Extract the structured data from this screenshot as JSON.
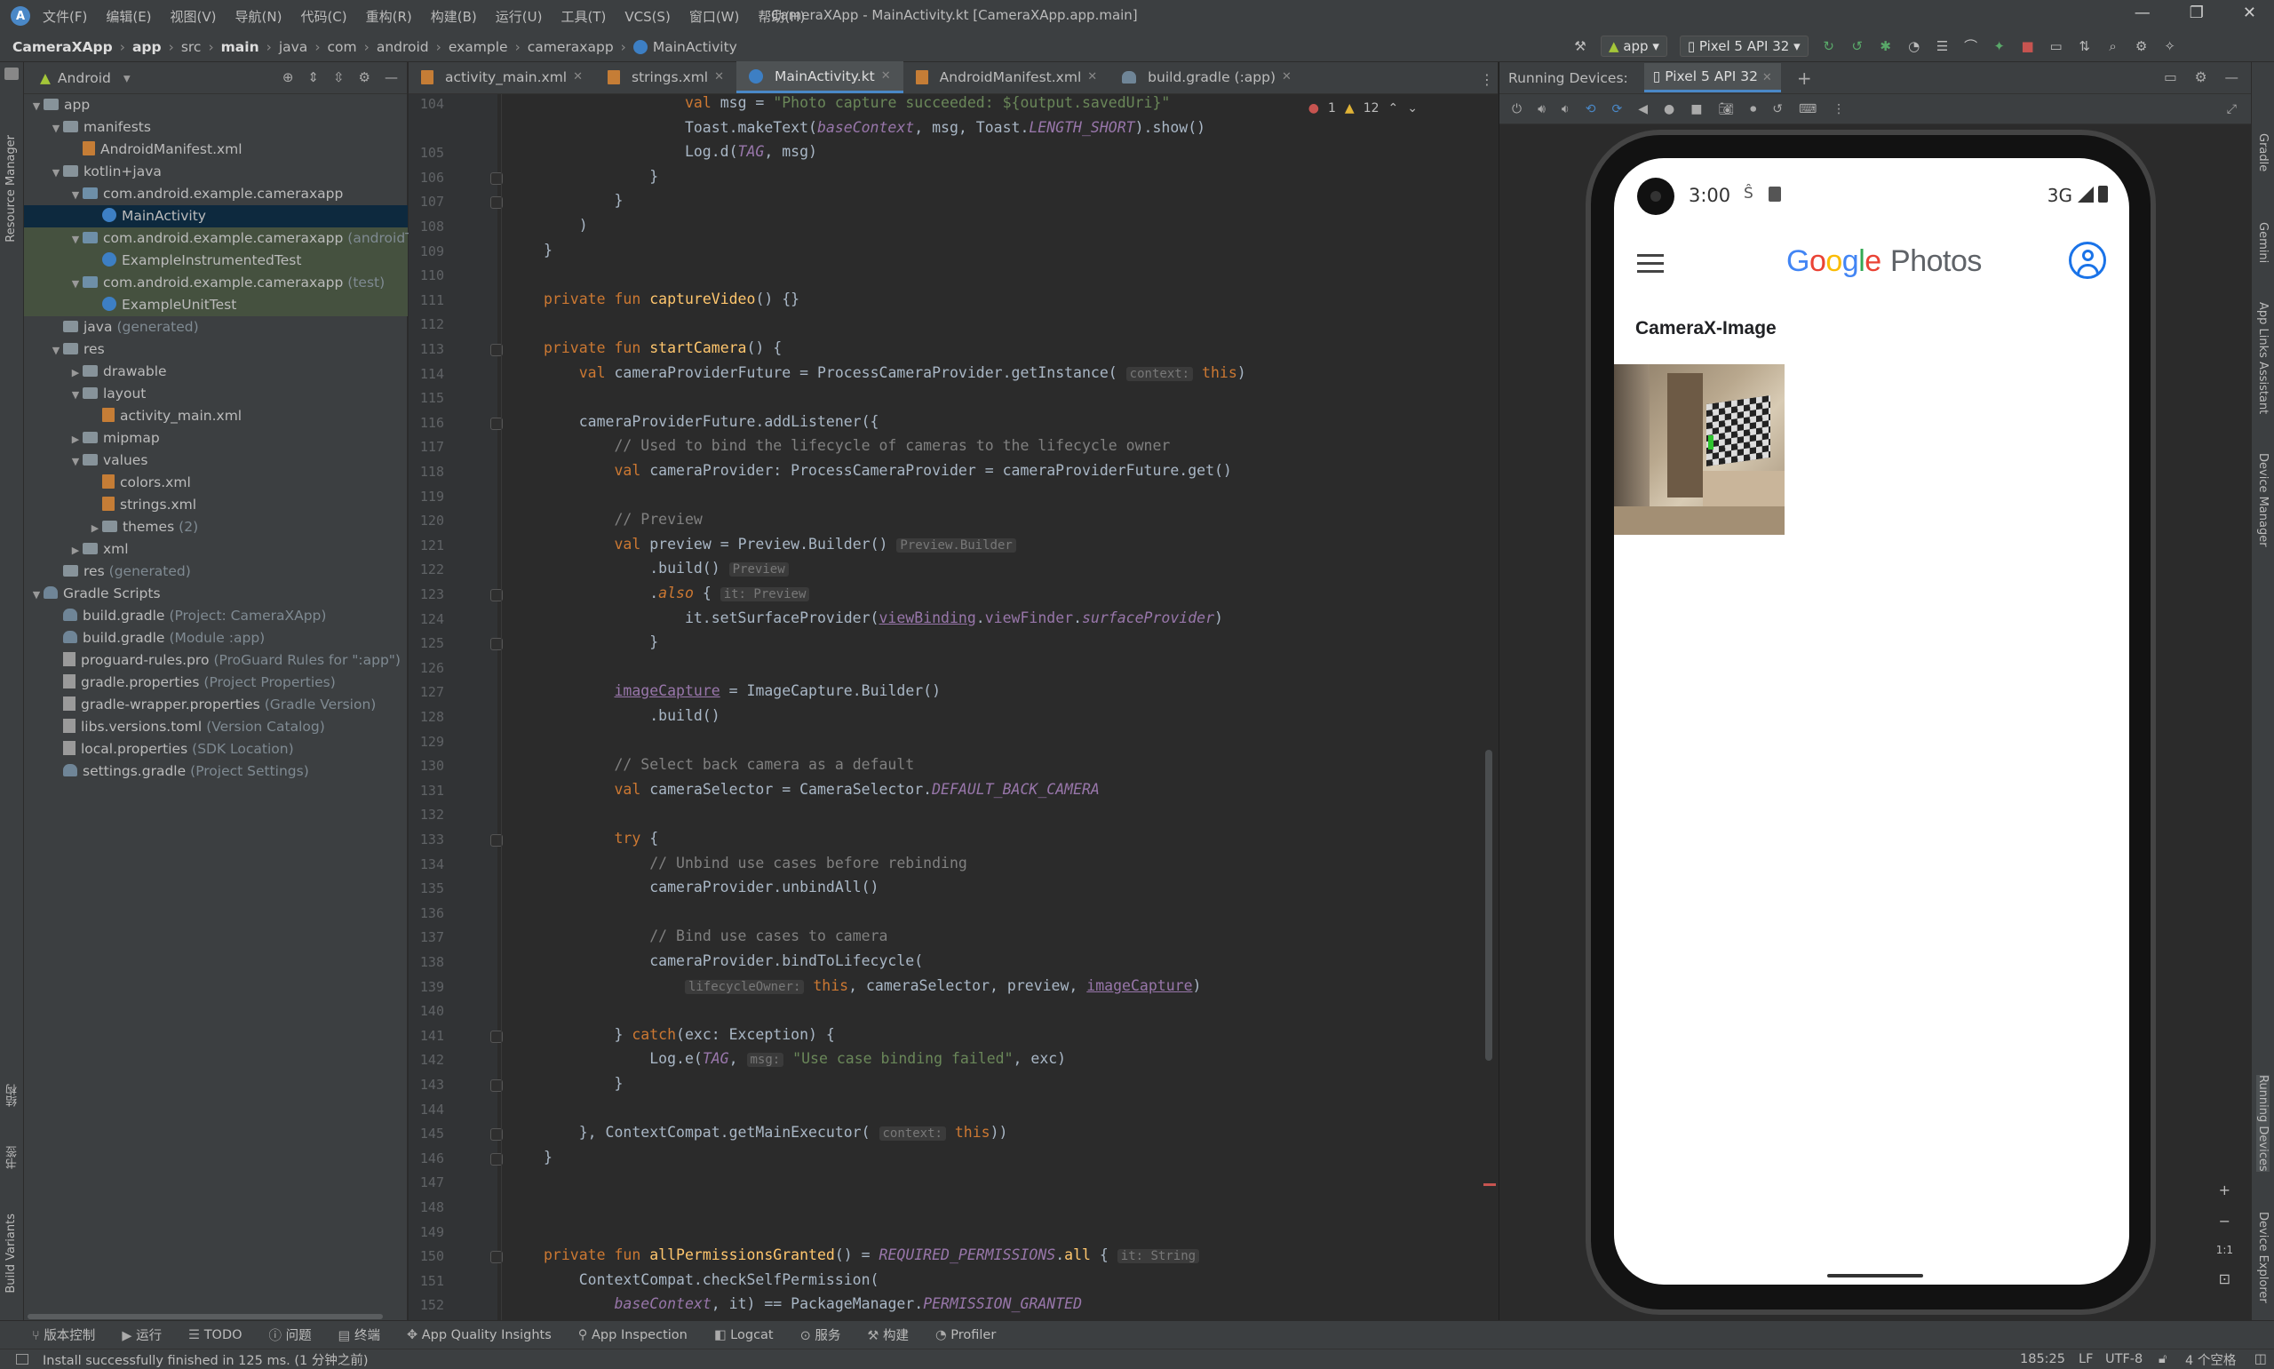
{
  "titlebar": {
    "menus": [
      "文件(F)",
      "编辑(E)",
      "视图(V)",
      "导航(N)",
      "代码(C)",
      "重构(R)",
      "构建(B)",
      "运行(U)",
      "工具(T)",
      "VCS(S)",
      "窗口(W)",
      "帮助(H)"
    ],
    "window_title": "CameraXApp - MainActivity.kt [CameraXApp.app.main]"
  },
  "breadcrumb": [
    "CameraXApp",
    "app",
    "src",
    "main",
    "java",
    "com",
    "android",
    "example",
    "cameraxapp",
    "MainActivity"
  ],
  "toolbar": {
    "run_config": "app",
    "device": "Pixel 5 API 32"
  },
  "project": {
    "view": "Android",
    "tree": [
      {
        "label": "app",
        "depth": 0,
        "arrow": "▼",
        "icon": "fold",
        "dim": ""
      },
      {
        "label": "manifests",
        "depth": 1,
        "arrow": "▼",
        "icon": "fold",
        "dim": ""
      },
      {
        "label": "AndroidManifest.xml",
        "depth": 2,
        "arrow": "",
        "icon": "xml",
        "dim": ""
      },
      {
        "label": "kotlin+java",
        "depth": 1,
        "arrow": "▼",
        "icon": "fold",
        "dim": ""
      },
      {
        "label": "com.android.example.cameraxapp",
        "depth": 2,
        "arrow": "▼",
        "icon": "pkg",
        "dim": ""
      },
      {
        "label": "MainActivity",
        "depth": 3,
        "arrow": "",
        "icon": "kt",
        "dim": "",
        "state": "sel"
      },
      {
        "label": "com.android.example.cameraxapp",
        "depth": 2,
        "arrow": "▼",
        "icon": "pkg",
        "dim": "(androidTe",
        "state": "hl"
      },
      {
        "label": "ExampleInstrumentedTest",
        "depth": 3,
        "arrow": "",
        "icon": "kt",
        "dim": "",
        "state": "hl"
      },
      {
        "label": "com.android.example.cameraxapp",
        "depth": 2,
        "arrow": "▼",
        "icon": "pkg",
        "dim": "(test)",
        "state": "hl"
      },
      {
        "label": "ExampleUnitTest",
        "depth": 3,
        "arrow": "",
        "icon": "kt",
        "dim": "",
        "state": "hl"
      },
      {
        "label": "java",
        "depth": 1,
        "arrow": "",
        "icon": "fold",
        "dim": "(generated)"
      },
      {
        "label": "res",
        "depth": 1,
        "arrow": "▼",
        "icon": "fold",
        "dim": ""
      },
      {
        "label": "drawable",
        "depth": 2,
        "arrow": "▶",
        "icon": "fold",
        "dim": ""
      },
      {
        "label": "layout",
        "depth": 2,
        "arrow": "▼",
        "icon": "fold",
        "dim": ""
      },
      {
        "label": "activity_main.xml",
        "depth": 3,
        "arrow": "",
        "icon": "xml",
        "dim": ""
      },
      {
        "label": "mipmap",
        "depth": 2,
        "arrow": "▶",
        "icon": "fold",
        "dim": ""
      },
      {
        "label": "values",
        "depth": 2,
        "arrow": "▼",
        "icon": "fold",
        "dim": ""
      },
      {
        "label": "colors.xml",
        "depth": 3,
        "arrow": "",
        "icon": "xml",
        "dim": ""
      },
      {
        "label": "strings.xml",
        "depth": 3,
        "arrow": "",
        "icon": "xml",
        "dim": ""
      },
      {
        "label": "themes",
        "depth": 3,
        "arrow": "▶",
        "icon": "fold",
        "dim": "(2)"
      },
      {
        "label": "xml",
        "depth": 2,
        "arrow": "▶",
        "icon": "fold",
        "dim": ""
      },
      {
        "label": "res",
        "depth": 1,
        "arrow": "",
        "icon": "fold",
        "dim": "(generated)"
      },
      {
        "label": "Gradle Scripts",
        "depth": 0,
        "arrow": "▼",
        "icon": "gr",
        "dim": ""
      },
      {
        "label": "build.gradle",
        "depth": 1,
        "arrow": "",
        "icon": "gr",
        "dim": "(Project: CameraXApp)"
      },
      {
        "label": "build.gradle",
        "depth": 1,
        "arrow": "",
        "icon": "gr",
        "dim": "(Module :app)"
      },
      {
        "label": "proguard-rules.pro",
        "depth": 1,
        "arrow": "",
        "icon": "prop",
        "dim": "(ProGuard Rules for \":app\")"
      },
      {
        "label": "gradle.properties",
        "depth": 1,
        "arrow": "",
        "icon": "prop",
        "dim": "(Project Properties)"
      },
      {
        "label": "gradle-wrapper.properties",
        "depth": 1,
        "arrow": "",
        "icon": "prop",
        "dim": "(Gradle Version)"
      },
      {
        "label": "libs.versions.toml",
        "depth": 1,
        "arrow": "",
        "icon": "prop",
        "dim": "(Version Catalog)"
      },
      {
        "label": "local.properties",
        "depth": 1,
        "arrow": "",
        "icon": "prop",
        "dim": "(SDK Location)"
      },
      {
        "label": "settings.gradle",
        "depth": 1,
        "arrow": "",
        "icon": "gr",
        "dim": "(Project Settings)"
      }
    ]
  },
  "tabs": [
    {
      "label": "activity_main.xml",
      "icon": "xml",
      "active": false
    },
    {
      "label": "strings.xml",
      "icon": "xml",
      "active": false
    },
    {
      "label": "MainActivity.kt",
      "icon": "kt",
      "active": true
    },
    {
      "label": "AndroidManifest.xml",
      "icon": "xml",
      "active": false
    },
    {
      "label": "build.gradle (:app)",
      "icon": "gr",
      "active": false
    }
  ],
  "inspections": {
    "errors": "1",
    "warnings": "12"
  },
  "code": [
    {
      "n": "104",
      "html": "                <span class=\"kw\">val</span> msg = <span class=\"st\">\"Photo capture succeeded: ${output.savedUri}\"</span>"
    },
    {
      "n": "",
      "html": "                Toast.makeText(<span class=\"pu\">baseContext</span>, msg, Toast.<span class=\"pu\">LENGTH_SHORT</span>).show()"
    },
    {
      "n": "105",
      "html": "                Log.d(<span class=\"pu\">TAG</span>, msg)"
    },
    {
      "n": "106",
      "html": "            }"
    },
    {
      "n": "107",
      "html": "        }"
    },
    {
      "n": "108",
      "html": "    )"
    },
    {
      "n": "109",
      "html": "}"
    },
    {
      "n": "110",
      "html": ""
    },
    {
      "n": "111",
      "html": "<span class=\"kw\">private fun</span> <span class=\"fn\">captureVideo</span>() {}"
    },
    {
      "n": "112",
      "html": ""
    },
    {
      "n": "113",
      "html": "<span class=\"kw\">private fun</span> <span class=\"fn\">startCamera</span>() {"
    },
    {
      "n": "114",
      "html": "    <span class=\"kw\">val</span> cameraProviderFuture = ProcessCameraProvider.getInstance( <span class=\"hint\">context:</span> <span class=\"kw\">this</span>)"
    },
    {
      "n": "115",
      "html": ""
    },
    {
      "n": "116",
      "html": "    cameraProviderFuture.addListener({"
    },
    {
      "n": "117",
      "html": "        <span class=\"cm\">// Used to bind the lifecycle of cameras to the lifecycle owner</span>"
    },
    {
      "n": "118",
      "html": "        <span class=\"kw\">val</span> cameraProvider: ProcessCameraProvider = cameraProviderFuture.get()"
    },
    {
      "n": "119",
      "html": ""
    },
    {
      "n": "120",
      "html": "        <span class=\"cm\">// Preview</span>"
    },
    {
      "n": "121",
      "html": "        <span class=\"kw\">val</span> preview = Preview.Builder() <span class=\"hint\">Preview.Builder</span>"
    },
    {
      "n": "122",
      "html": "            .build() <span class=\"hint\">Preview</span>"
    },
    {
      "n": "123",
      "html": "            .<span class=\"fn\" style=\"color:#cc7832;font-style:italic\">also</span> { <span class=\"hint\">it: Preview</span>"
    },
    {
      "n": "124",
      "html": "                it.setSurfaceProvider(<span class=\"ul\">viewBinding</span>.<span style=\"color:#9876aa\">viewFinder</span>.<span class=\"pu\">surfaceProvider</span>)"
    },
    {
      "n": "125",
      "html": "            }"
    },
    {
      "n": "126",
      "html": ""
    },
    {
      "n": "127",
      "html": "        <span class=\"ul\">imageCapture</span> = ImageCapture.Builder()"
    },
    {
      "n": "128",
      "html": "            .build()"
    },
    {
      "n": "129",
      "html": ""
    },
    {
      "n": "130",
      "html": "        <span class=\"cm\">// Select back camera as a default</span>"
    },
    {
      "n": "131",
      "html": "        <span class=\"kw\">val</span> cameraSelector = CameraSelector.<span class=\"pu\">DEFAULT_BACK_CAMERA</span>"
    },
    {
      "n": "132",
      "html": ""
    },
    {
      "n": "133",
      "html": "        <span class=\"kw\">try</span> {"
    },
    {
      "n": "134",
      "html": "            <span class=\"cm\">// Unbind use cases before rebinding</span>"
    },
    {
      "n": "135",
      "html": "            cameraProvider.unbindAll()"
    },
    {
      "n": "136",
      "html": ""
    },
    {
      "n": "137",
      "html": "            <span class=\"cm\">// Bind use cases to camera</span>"
    },
    {
      "n": "138",
      "html": "            cameraProvider.bindToLifecycle("
    },
    {
      "n": "139",
      "html": "                <span class=\"hint\">lifecycleOwner:</span> <span class=\"kw\">this</span>, cameraSelector, preview, <span class=\"ul\">imageCapture</span>)"
    },
    {
      "n": "140",
      "html": ""
    },
    {
      "n": "141",
      "html": "        } <span class=\"kw\">catch</span>(exc: Exception) {"
    },
    {
      "n": "142",
      "html": "            Log.e(<span class=\"pu\">TAG</span>, <span class=\"hint\">msg:</span> <span class=\"st\">\"Use case binding failed\"</span>, exc)"
    },
    {
      "n": "143",
      "html": "        }"
    },
    {
      "n": "144",
      "html": ""
    },
    {
      "n": "145",
      "html": "    }, ContextCompat.getMainExecutor( <span class=\"hint\">context:</span> <span class=\"kw\">this</span>))"
    },
    {
      "n": "146",
      "html": "}"
    },
    {
      "n": "147",
      "html": ""
    },
    {
      "n": "148",
      "html": ""
    },
    {
      "n": "149",
      "html": ""
    },
    {
      "n": "150",
      "html": "<span class=\"kw\">private fun</span> <span class=\"fn\">allPermissionsGranted</span>() = <span class=\"pu\">REQUIRED_PERMISSIONS</span>.<span class=\"fn\">all</span> { <span class=\"hint\">it: String</span>"
    },
    {
      "n": "151",
      "html": "    ContextCompat.checkSelfPermission("
    },
    {
      "n": "152",
      "html": "        <span class=\"pu\">baseContext</span>, it) == PackageManager.<span class=\"pu\">PERMISSION_GRANTED</span>"
    },
    {
      "n": "153",
      "html": "}"
    }
  ],
  "running_devices": {
    "label": "Running Devices:",
    "device_tab": "Pixel 5 API 32"
  },
  "phone": {
    "time": "3:00",
    "network": "3G",
    "brand_google": "Google",
    "brand_photos": "Photos",
    "album_title": "CameraX-Image"
  },
  "bottom_tools": [
    "版本控制",
    "运行",
    "TODO",
    "问题",
    "终端",
    "App Quality Insights",
    "App Inspection",
    "Logcat",
    "服务",
    "构建",
    "Profiler"
  ],
  "status": {
    "message": "Install successfully finished in 125 ms. (1 分钟之前)",
    "position": "185:25",
    "line_sep": "LF",
    "encoding": "UTF-8",
    "indent": "4 个空格"
  },
  "left_strip": [
    "Resource Manager",
    "结构",
    "书签",
    "Build Variants"
  ],
  "right_strip": [
    "Gradle",
    "Gemini",
    "App Links Assistant",
    "Device Manager",
    "Running Devices",
    "Device Explorer"
  ],
  "colors": {
    "accent": "#4a88c7",
    "editor_bg": "#2b2b2b",
    "panel_bg": "#3c3f41",
    "google_blue": "#4285F4",
    "google_red": "#EA4335",
    "google_yellow": "#FBBC05",
    "google_green": "#34A853"
  }
}
